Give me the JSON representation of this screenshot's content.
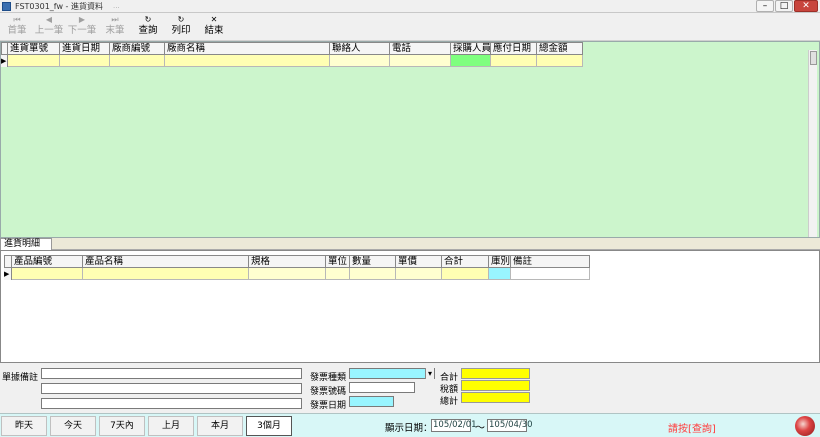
{
  "window": {
    "title": "FST0301_fw - 進貨資料",
    "title_extra": "...",
    "min_label": "–",
    "max_label": "□",
    "close_label": "✕"
  },
  "toolbar": {
    "buttons": [
      {
        "icon": "⏮",
        "label": "首筆"
      },
      {
        "icon": "◀",
        "label": "上一筆"
      },
      {
        "icon": "▶",
        "label": "下一筆"
      },
      {
        "icon": "⏭",
        "label": "末筆"
      },
      {
        "icon": "↻",
        "label": "查詢"
      },
      {
        "icon": "↻",
        "label": "列印"
      },
      {
        "icon": "✕",
        "label": "結束"
      }
    ]
  },
  "master_grid": {
    "columns": [
      "進貨單號",
      "進貨日期",
      "廠商編號",
      "廠商名稱",
      "聯絡人",
      "電話",
      "採購人員",
      "應付日期",
      "總金額"
    ],
    "row_indicator": "▶"
  },
  "detail_tab": {
    "label": "進貨明細"
  },
  "detail_grid": {
    "columns": [
      "產品編號",
      "產品名稱",
      "規格",
      "單位",
      "數量",
      "單價",
      "合計",
      "庫別",
      "備註"
    ],
    "row_indicator": "▶"
  },
  "form": {
    "note_label": "單據備註",
    "invoice_type_label": "發票種類",
    "invoice_no_label": "發票號碼",
    "invoice_date_label": "發票日期",
    "dropdown_arrow": "▾",
    "subtotal_label": "合計",
    "tax_label": "稅額",
    "total_label": "總計"
  },
  "footer": {
    "buttons": [
      "昨天",
      "今天",
      "7天內",
      "上月",
      "本月",
      "3個月"
    ],
    "display_date_label": "顯示日期：",
    "date_from": "105/02/01",
    "tilde": "～",
    "date_to": "105/04/30",
    "status": "請按[查詢]",
    "status_color": "#ff3b3b"
  },
  "colors": {
    "master_bg": "#ccf5cc",
    "yellow_cell": "#ffffb3",
    "green_cell": "#7fff7f",
    "cyan_cell": "#99f5ff",
    "total_yellow": "#ffff00"
  }
}
